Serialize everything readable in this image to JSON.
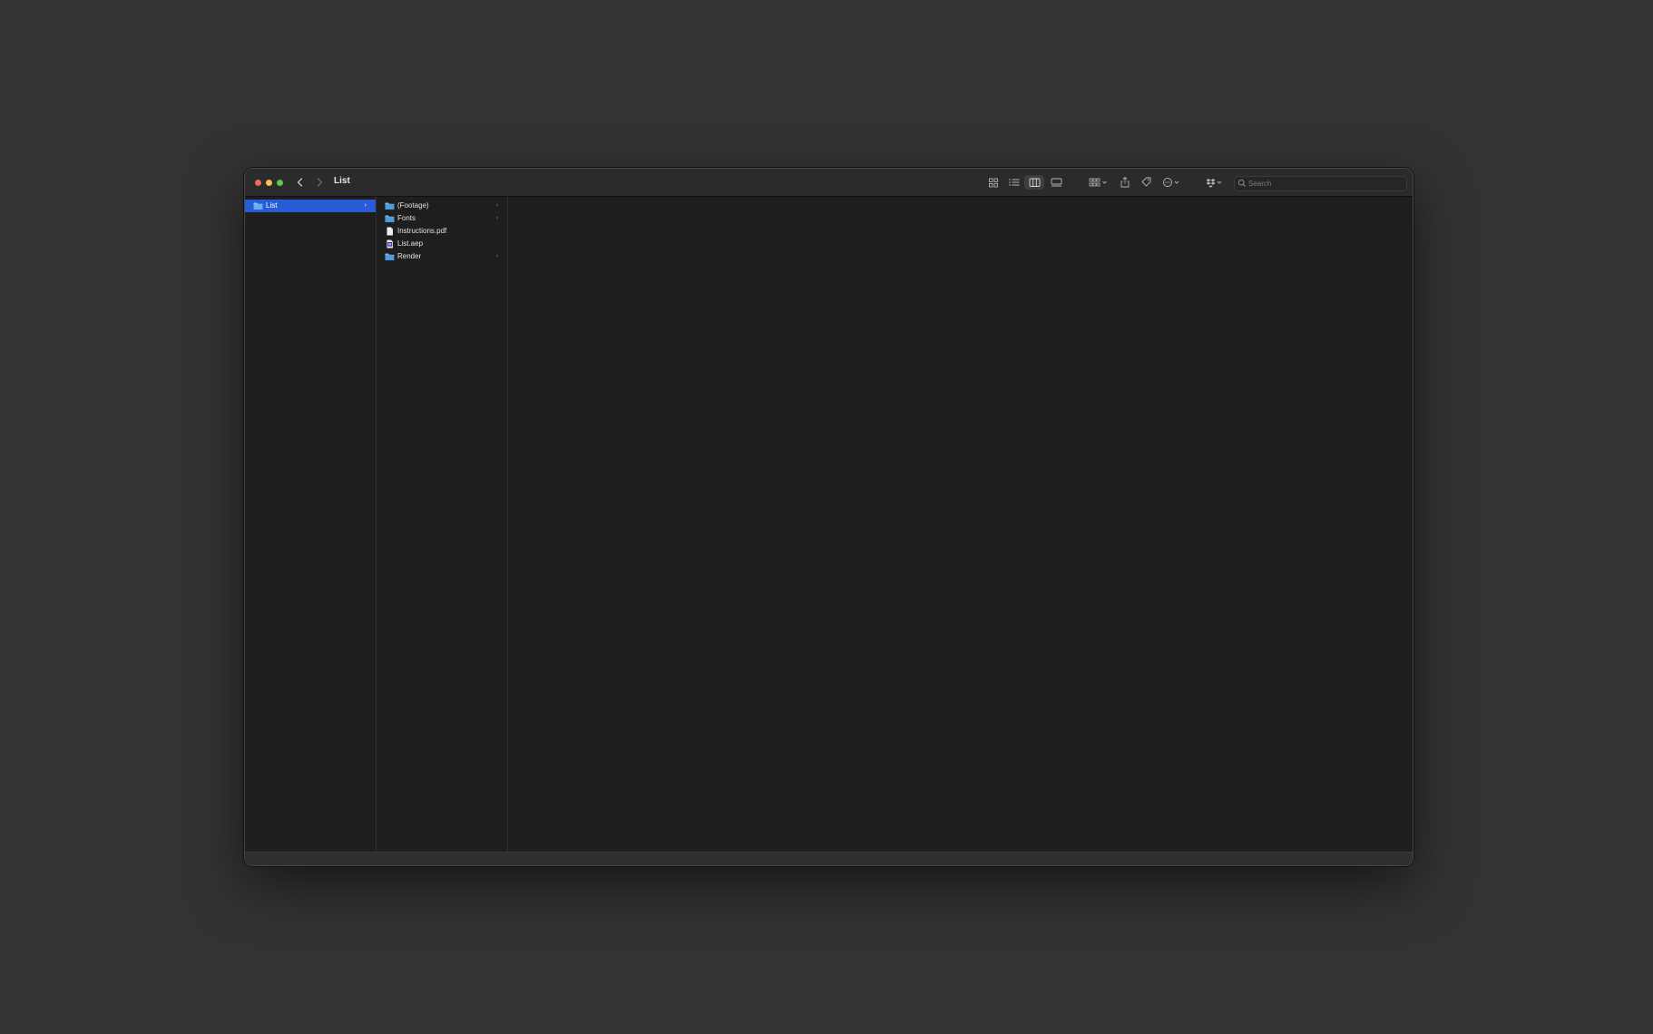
{
  "window": {
    "title": "List"
  },
  "toolbar": {
    "search_placeholder": "Search",
    "icons": [
      "icon-view-grid",
      "list-view-icon",
      "column-view-icon",
      "gallery-view-icon",
      "group-icon",
      "share-icon",
      "tag-icon",
      "more-actions-icon",
      "dropbox-icon",
      "search-icon"
    ]
  },
  "sidebar_column": {
    "items": [
      {
        "label": "List",
        "selected": true,
        "has_children": true
      }
    ]
  },
  "content_column": {
    "items": [
      {
        "label": "(Footage)",
        "type": "folder",
        "has_children": true
      },
      {
        "label": "Fonts",
        "type": "folder",
        "has_children": true
      },
      {
        "label": "Instructions.pdf",
        "type": "pdf",
        "has_children": false
      },
      {
        "label": "List.aep",
        "type": "aep",
        "has_children": false
      },
      {
        "label": "Render",
        "type": "folder",
        "has_children": true
      }
    ]
  },
  "colors": {
    "selection": "#2a5bd7",
    "folder": "#5aa9e6",
    "close": "#ec6a5e",
    "minimize": "#f4bf4f",
    "maximize": "#61c554"
  }
}
